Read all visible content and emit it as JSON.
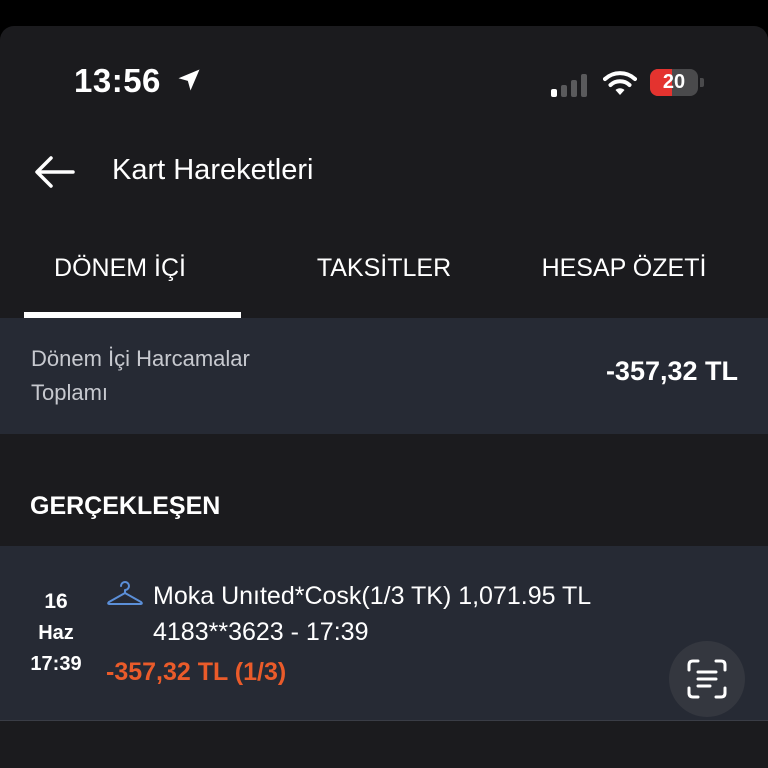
{
  "status_bar": {
    "time": "13:56",
    "battery": "20",
    "battery_color": "#e4332f",
    "icons": [
      "location-arrow-icon",
      "cellular-signal-icon",
      "wifi-icon",
      "battery-icon"
    ]
  },
  "header": {
    "back_icon": "arrow-left-icon",
    "title": "Kart Hareketleri"
  },
  "tabs": [
    {
      "label": "DÖNEM İÇİ",
      "active": true
    },
    {
      "label": "TAKSİTLER",
      "active": false
    },
    {
      "label": "HESAP ÖZETİ",
      "active": false
    }
  ],
  "summary": {
    "label": "Dönem İçi Harcamalar Toplamı",
    "amount": "-357,32 TL"
  },
  "section": {
    "heading": "GERÇEKLEŞEN"
  },
  "transactions": [
    {
      "day": "16",
      "month": "Haz",
      "time": "17:39",
      "category_icon": "hanger-icon",
      "description": "Moka Unıted*Cosk(1/3 TK) 1,071.95 TL",
      "card_info": "4183**3623 - 17:39",
      "amount": "-357,32 TL (1/3)",
      "amount_color": "#ea5b2a"
    }
  ],
  "floating_button": {
    "icon": "scan-text-icon"
  }
}
